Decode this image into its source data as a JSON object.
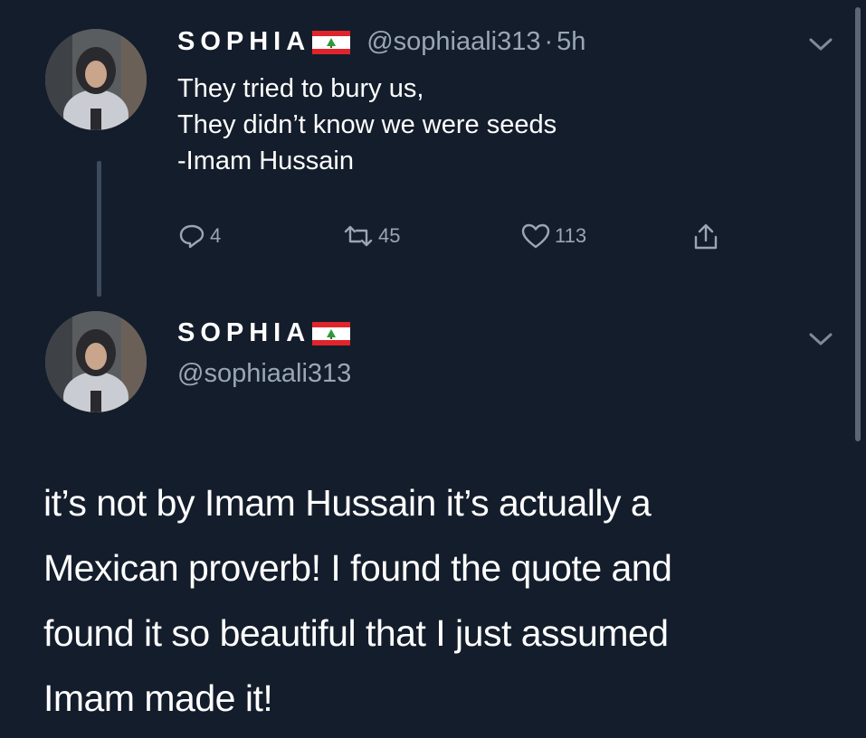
{
  "tweet": {
    "display_name": "SOPHIA",
    "handle": "@sophiaali313",
    "dot": "·",
    "time": "5h",
    "lines": [
      "They tried to bury us,",
      "They didn’t know we were seeds",
      "-Imam Hussain"
    ],
    "actions": {
      "replies": "4",
      "retweets": "45",
      "likes": "113"
    }
  },
  "reply": {
    "display_name": "SOPHIA",
    "handle": "@sophiaali313",
    "lines": [
      "it’s not by Imam Hussain it’s actually a",
      "Mexican proverb! I found the quote and",
      "found it so beautiful that I just assumed",
      "Imam made it!"
    ]
  },
  "icons": {
    "avatar": "avatar-photo",
    "flag": "lebanon-flag-icon",
    "chevron": "chevron-down-icon",
    "reply": "reply-icon",
    "retweet": "retweet-icon",
    "like": "heart-icon",
    "share": "share-icon"
  },
  "colors": {
    "background": "#141d2b",
    "secondary_text": "#9aa6b5",
    "primary_text": "#ffffff"
  }
}
